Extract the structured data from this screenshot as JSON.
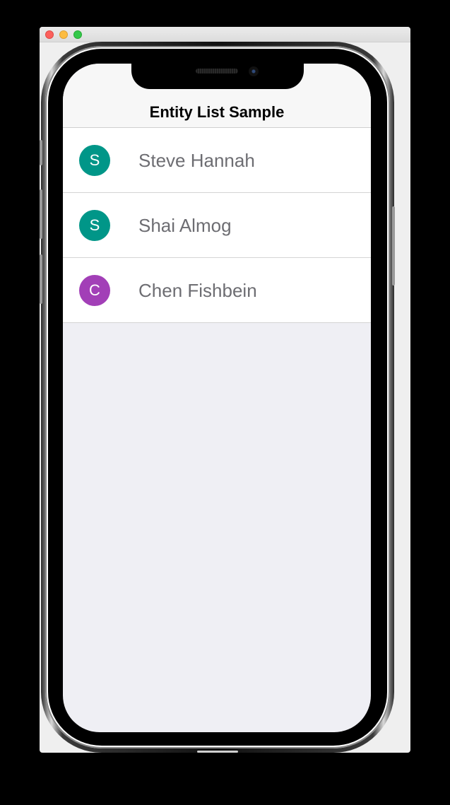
{
  "window": {
    "controls": [
      "close",
      "minimize",
      "maximize"
    ]
  },
  "nav": {
    "title": "Entity List Sample"
  },
  "entities": [
    {
      "initial": "S",
      "name": "Steve Hannah",
      "color": "#009688"
    },
    {
      "initial": "S",
      "name": "Shai Almog",
      "color": "#009688"
    },
    {
      "initial": "C",
      "name": "Chen Fishbein",
      "color": "#a23fb7"
    }
  ]
}
